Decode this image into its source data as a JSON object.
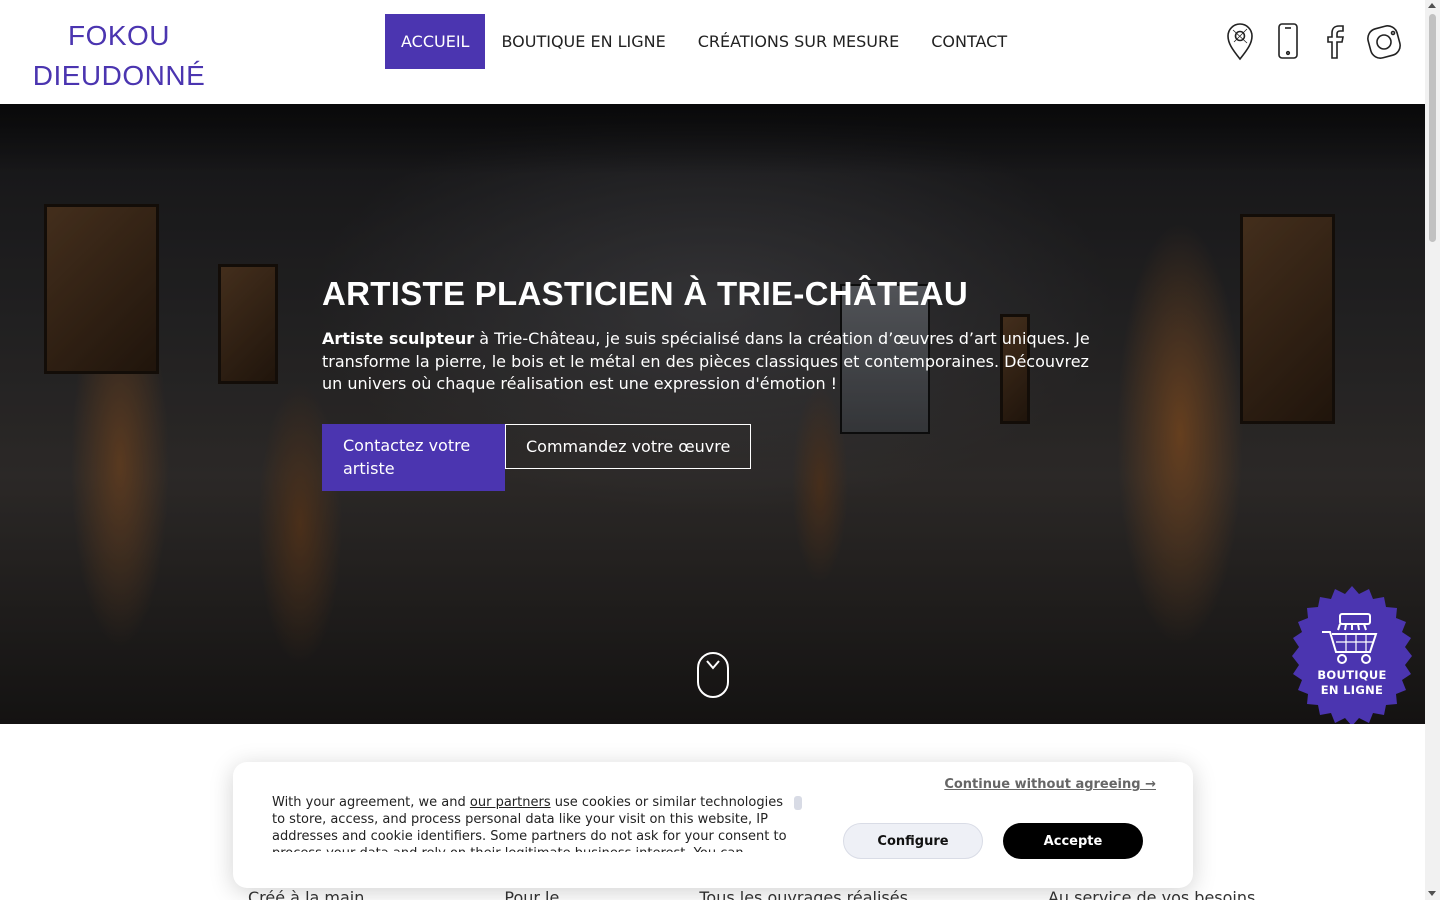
{
  "logo": {
    "line1": "FOKOU",
    "line2": "DIEUDONNÉ"
  },
  "nav": {
    "items": [
      {
        "label": "ACCUEIL",
        "active": true
      },
      {
        "label": "BOUTIQUE EN LIGNE",
        "active": false
      },
      {
        "label": "CRÉATIONS SUR MESURE",
        "active": false
      },
      {
        "label": "CONTACT",
        "active": false
      }
    ]
  },
  "header_icons": [
    "map-pin-icon",
    "phone-icon",
    "facebook-icon",
    "instagram-icon"
  ],
  "hero": {
    "title": "ARTISTE PLASTICIEN À TRIE-CHÂTEAU",
    "text_strong": "Artiste sculpteur",
    "text_rest": " à Trie-Château, je suis spécialisé dans la création d’œuvres d’art uniques. Je transforme la pierre, le bois et le métal en des pièces classiques et contemporaines. Découvrez un univers où chaque réalisation est une expression d'émotion !",
    "btn_primary": "Contactez votre artiste",
    "btn_secondary": "Commandez votre œuvre"
  },
  "shop_badge": {
    "line1": "BOUTIQUE",
    "line2": "EN LIGNE"
  },
  "peek": [
    "Créé à la main",
    "Pour le",
    "Tous les ouvrages réalisés",
    "Au service de vos besoins"
  ],
  "cookie": {
    "text_before_link": "With your agreement, we and ",
    "link": "our partners",
    "text_after_link": " use cookies or similar technologies to store, access, and process personal data like your visit on this website, IP addresses and cookie identifiers. Some partners do not ask for your consent to process your data and rely on their legitimate business interest. You can",
    "continue": "Continue without agreeing →",
    "configure": "Configure",
    "accept": "Accepte"
  },
  "colors": {
    "accent": "#4b35b0",
    "white": "#ffffff",
    "black": "#000000"
  }
}
